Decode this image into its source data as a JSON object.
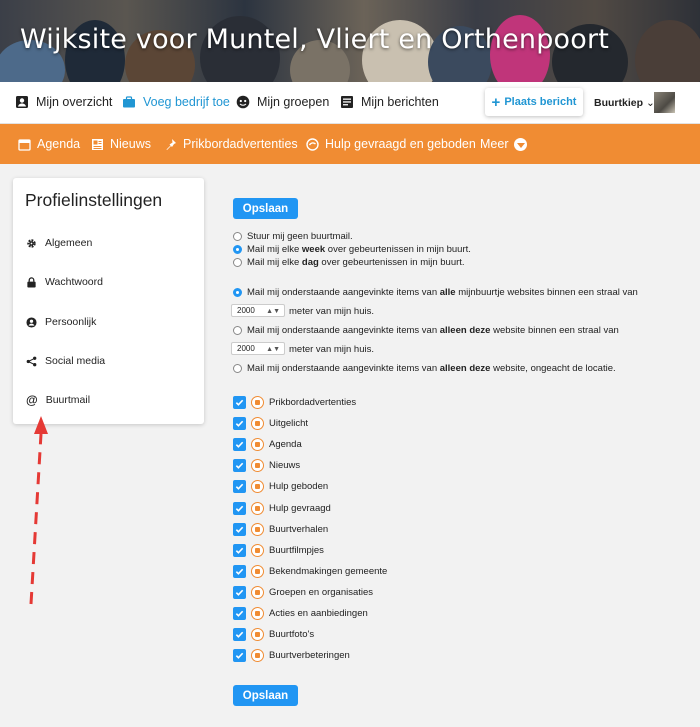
{
  "site": {
    "title": "Wijksite voor Muntel, Vliert en Orthenpoort"
  },
  "topnav": {
    "items": [
      {
        "label": "Mijn overzicht",
        "icon": "person-card-icon"
      },
      {
        "label": "Voeg bedrijf toe",
        "icon": "briefcase-icon"
      },
      {
        "label": "Mijn groepen",
        "icon": "group-icon"
      },
      {
        "label": "Mijn berichten",
        "icon": "messages-icon"
      }
    ],
    "post_button": "Plaats bericht",
    "user": "Buurtkiep"
  },
  "orangenav": {
    "items": [
      {
        "label": "Agenda",
        "icon": "calendar-icon"
      },
      {
        "label": "Nieuws",
        "icon": "newspaper-icon"
      },
      {
        "label": "Prikbordadvertenties",
        "icon": "pin-icon"
      },
      {
        "label": "Hulp gevraagd en geboden",
        "icon": "help-hand-icon"
      },
      {
        "label": "Meer",
        "icon": "chevron-down-icon"
      }
    ]
  },
  "sidebar": {
    "title": "Profielinstellingen",
    "items": [
      {
        "label": "Algemeen",
        "icon": "gear-icon"
      },
      {
        "label": "Wachtwoord",
        "icon": "lock-icon"
      },
      {
        "label": "Persoonlijk",
        "icon": "person-icon"
      },
      {
        "label": "Social media",
        "icon": "share-icon"
      },
      {
        "label": "Buurtmail",
        "icon": "at-icon"
      }
    ]
  },
  "main": {
    "save_label": "Opslaan",
    "frequency": [
      {
        "pre": "Stuur mij geen buurtmail.",
        "bold": "",
        "post": "",
        "selected": false
      },
      {
        "pre": "Mail mij elke ",
        "bold": "week",
        "post": " over gebeurtenissen in mijn buurt.",
        "selected": true
      },
      {
        "pre": "Mail mij elke ",
        "bold": "dag",
        "post": " over gebeurtenissen in mijn buurt.",
        "selected": false
      }
    ],
    "scope": [
      {
        "pre": "Mail mij onderstaande aangevinkte items van ",
        "bold": "alle",
        "post": " mijnbuurtje websites binnen een straal van",
        "selected": true
      },
      {
        "pre": "Mail mij onderstaande aangevinkte items van ",
        "bold": "alleen deze",
        "post": " website binnen een straal van",
        "selected": false
      },
      {
        "pre": "Mail mij onderstaande aangevinkte items van ",
        "bold": "alleen deze",
        "post": " website, ongeacht de locatie.",
        "selected": false
      }
    ],
    "distance_1": "2000",
    "distance_2": "2000",
    "distance_suffix": "meter van mijn huis.",
    "categories": [
      {
        "label": "Prikbordadvertenties",
        "checked": true
      },
      {
        "label": "Uitgelicht",
        "checked": true
      },
      {
        "label": "Agenda",
        "checked": true
      },
      {
        "label": "Nieuws",
        "checked": true
      },
      {
        "label": "Hulp geboden",
        "checked": true
      },
      {
        "label": "Hulp gevraagd",
        "checked": true
      },
      {
        "label": "Buurtverhalen",
        "checked": true
      },
      {
        "label": "Buurtfilmpjes",
        "checked": true
      },
      {
        "label": "Bekendmakingen gemeente",
        "checked": true
      },
      {
        "label": "Groepen en organisaties",
        "checked": true
      },
      {
        "label": "Acties en aanbiedingen",
        "checked": true
      },
      {
        "label": "Buurtfoto's",
        "checked": true
      },
      {
        "label": "Buurtverbeteringen",
        "checked": true
      }
    ]
  },
  "colors": {
    "accent": "#2196f3",
    "orange": "#f08c33",
    "annotation_arrow": "#e53935"
  }
}
